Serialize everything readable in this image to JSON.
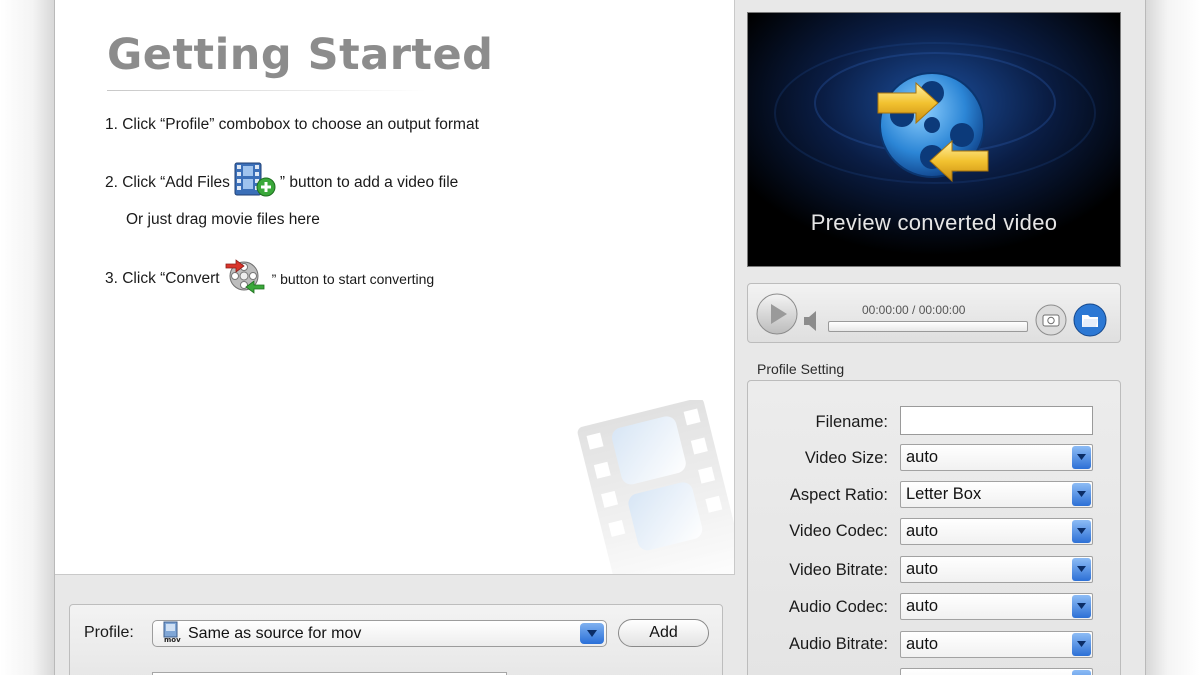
{
  "getting_started": {
    "title": "Getting Started",
    "step1": "1. Click “Profile” combobox to choose an output format",
    "step2_pre": "2. Click “Add Files",
    "step2_post": "” button to add a video file",
    "step2_alt": "Or just drag movie files here",
    "step3_pre": "3. Click “Convert",
    "step3_post": "” button to start converting"
  },
  "profile_bar": {
    "label": "Profile:",
    "selected": "Same as source for mov",
    "icon_text": "mov",
    "add_label": "Add"
  },
  "preview": {
    "caption": "Preview converted video"
  },
  "player": {
    "time": "00:00:00 / 00:00:00"
  },
  "profile_setting": {
    "title": "Profile Setting",
    "filename_label": "Filename:",
    "filename_value": "",
    "fields": [
      {
        "label": "Video Size:",
        "value": "auto"
      },
      {
        "label": "Aspect Ratio:",
        "value": "Letter Box"
      },
      {
        "label": "Video Codec:",
        "value": "auto"
      },
      {
        "label": "Video Bitrate:",
        "value": "auto"
      },
      {
        "label": "Audio Codec:",
        "value": "auto"
      },
      {
        "label": "Audio Bitrate:",
        "value": "auto"
      }
    ]
  },
  "colors": {
    "accent_blue": "#2a6fd8",
    "title_gray": "#8c8c8c",
    "arrow_gold": "#f2c230"
  }
}
